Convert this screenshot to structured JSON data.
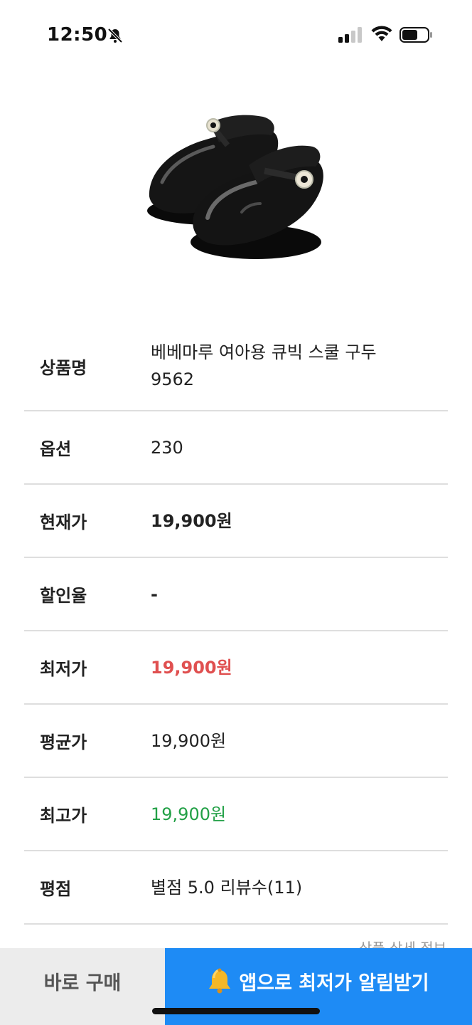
{
  "status_bar": {
    "time": "12:50",
    "icons": [
      "bell-off-icon",
      "signal-icon",
      "wifi-icon",
      "battery-icon"
    ]
  },
  "product": {
    "image_icon": "shoe-product-image",
    "rows": [
      {
        "label": "상품명",
        "value": "베베마루 여아용 큐빅 스쿨 구두 9562"
      },
      {
        "label": "옵션",
        "value": "230"
      },
      {
        "label": "현재가",
        "value": "19,900원"
      },
      {
        "label": "할인율",
        "value": "-"
      },
      {
        "label": "최저가",
        "value": "19,900원",
        "color": "#e05050"
      },
      {
        "label": "평균가",
        "value": "19,900원"
      },
      {
        "label": "최고가",
        "value": "19,900원",
        "color": "#22a046"
      },
      {
        "label": "평점",
        "value": "별점 5.0 리뷰수(11)"
      }
    ],
    "detail_link": "상품 상세 정보"
  },
  "bottom_bar": {
    "buy_label": "바로 구매",
    "alert_label": "앱으로 최저가 알림받기",
    "alert_icon": "bell-icon",
    "accent_color": "#1e8bf5"
  }
}
